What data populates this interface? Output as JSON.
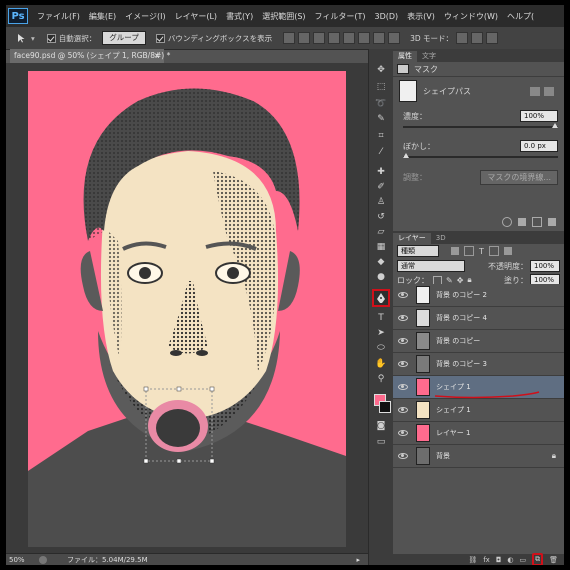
{
  "app": {
    "logo": "Ps"
  },
  "menubar": {
    "items": [
      "ファイル(F)",
      "編集(E)",
      "イメージ(I)",
      "レイヤー(L)",
      "書式(Y)",
      "選択範囲(S)",
      "フィルター(T)",
      "3D(D)",
      "表示(V)",
      "ウィンドウ(W)",
      "ヘルプ("
    ]
  },
  "options_bar": {
    "auto_select_label": "自動選択：",
    "auto_select_target": "グループ",
    "bounding_box_label": "バウンディングボックスを表示",
    "mode_3d_label": "3D モード："
  },
  "document": {
    "tab_label": "face90.psd @ 50% (シェイプ 1, RGB/8#) *",
    "close_glyph": "×",
    "zoom": "50%",
    "file_info": "ファイル：5.04M/29.5M"
  },
  "properties": {
    "tabs": [
      "属性",
      "文字"
    ],
    "mask_label": "マスク",
    "shape_path_label": "シェイプパス",
    "density_label": "濃度：",
    "density_value": "100%",
    "feather_label": "ぼかし：",
    "feather_value": "0.0 px",
    "adjust_label": "調整：",
    "mask_edge_button": "マスクの境界線..."
  },
  "layers_panel": {
    "tabs": [
      "レイヤー",
      "3D"
    ],
    "filter_label": "種類",
    "blend_mode": "通常",
    "opacity_label": "不透明度：",
    "opacity_value": "100%",
    "lock_label": "ロック：",
    "fill_label": "塗り：",
    "fill_value": "100%",
    "layers": [
      {
        "name": "背景 のコピー 2",
        "thumb": "#f0f0f0",
        "active": false
      },
      {
        "name": "背景 のコピー 4",
        "thumb": "#dcdcdc",
        "active": false
      },
      {
        "name": "背景 のコピー",
        "thumb": "#8a8a8a",
        "active": false
      },
      {
        "name": "背景 のコピー 3",
        "thumb": "#7a7a7a",
        "active": false
      },
      {
        "name": "シェイプ 1",
        "thumb": "#ff6b8e",
        "active": true
      },
      {
        "name": "シェイプ 1",
        "thumb": "#f4e3c3",
        "active": false
      },
      {
        "name": "レイヤー 1",
        "thumb": "#ff6b8e",
        "active": false
      },
      {
        "name": "背景",
        "thumb": "#6d6d6d",
        "active": false
      }
    ],
    "footer_icons": [
      "link-icon",
      "fx-icon",
      "mask-icon",
      "adjustment-icon",
      "folder-icon",
      "new-layer-icon",
      "trash-icon"
    ]
  },
  "colors": {
    "canvas_pink": "#ff6b8e",
    "skin": "#f4e3c3",
    "highlight_red": "#d0101a",
    "layer_active": "#5f6e82"
  }
}
